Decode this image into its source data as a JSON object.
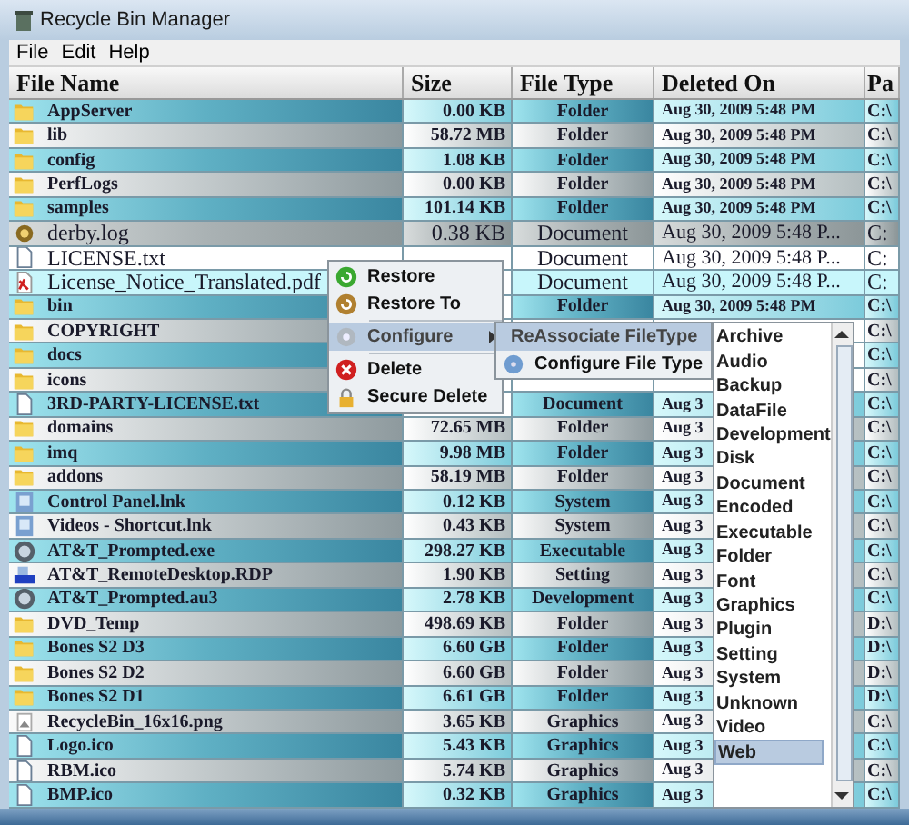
{
  "window": {
    "title": "Recycle Bin Manager"
  },
  "menu_bar": [
    "File",
    "Edit",
    "Help"
  ],
  "table": {
    "columns": [
      "File Name",
      "Size",
      "File Type",
      "Deleted On",
      "Pa"
    ],
    "rows": [
      {
        "name": "AppServer",
        "kind": "folder",
        "size": "0.00 KB",
        "type": "Folder",
        "deleted": "Aug 30, 2009 5:48 PM",
        "path": "C:\\",
        "selected": false
      },
      {
        "name": "lib",
        "kind": "folder",
        "size": "58.72 MB",
        "type": "Folder",
        "deleted": "Aug 30, 2009 5:48 PM",
        "path": "C:\\",
        "selected": false
      },
      {
        "name": "config",
        "kind": "folder",
        "size": "1.08 KB",
        "type": "Folder",
        "deleted": "Aug 30, 2009 5:48 PM",
        "path": "C:\\",
        "selected": false
      },
      {
        "name": "PerfLogs",
        "kind": "folder",
        "size": "0.00 KB",
        "type": "Folder",
        "deleted": "Aug 30, 2009 5:48 PM",
        "path": "C:\\",
        "selected": false
      },
      {
        "name": "samples",
        "kind": "folder",
        "size": "101.14 KB",
        "type": "Folder",
        "deleted": "Aug 30, 2009 5:48 PM",
        "path": "C:\\",
        "selected": false
      },
      {
        "name": "derby.log",
        "kind": "log",
        "size": "0.38 KB",
        "type": "Document",
        "deleted": "Aug 30, 2009 5:48 P...",
        "path": "C:",
        "selected": true
      },
      {
        "name": "LICENSE.txt",
        "kind": "file",
        "type": "Document",
        "deleted": "Aug 30, 2009 5:48 P...",
        "path": "C:",
        "selected": true
      },
      {
        "name": "License_Notice_Translated.pdf",
        "kind": "pdf",
        "type": "Document",
        "deleted": "Aug 30, 2009 5:48 P...",
        "path": "C:",
        "selected": true
      },
      {
        "name": "bin",
        "kind": "folder",
        "type": "Folder",
        "deleted": "Aug 30, 2009 5:48 PM",
        "path": "C:\\",
        "selected": false
      },
      {
        "name": "COPYRIGHT",
        "kind": "folder",
        "path": "C:\\",
        "selected": false
      },
      {
        "name": "docs",
        "kind": "folder",
        "path": "C:\\",
        "selected": false
      },
      {
        "name": "icons",
        "kind": "folder",
        "path": "C:\\",
        "selected": false
      },
      {
        "name": "3RD-PARTY-LICENSE.txt",
        "kind": "file",
        "type": "Document",
        "deleted": "Aug 3",
        "path": "C:\\",
        "selected": false
      },
      {
        "name": "domains",
        "kind": "folder",
        "size": "72.65 MB",
        "type": "Folder",
        "deleted": "Aug 3",
        "path": "C:\\",
        "selected": false
      },
      {
        "name": "imq",
        "kind": "folder",
        "size": "9.98 MB",
        "type": "Folder",
        "deleted": "Aug 3",
        "path": "C:\\",
        "selected": false
      },
      {
        "name": "addons",
        "kind": "folder",
        "size": "58.19 MB",
        "type": "Folder",
        "deleted": "Aug 3",
        "path": "C:\\",
        "selected": false
      },
      {
        "name": "Control Panel.lnk",
        "kind": "shortcut",
        "size": "0.12 KB",
        "type": "System",
        "deleted": "Aug 3",
        "path": "C:\\",
        "selected": false
      },
      {
        "name": "Videos - Shortcut.lnk",
        "kind": "shortcut",
        "size": "0.43 KB",
        "type": "System",
        "deleted": "Aug 3",
        "path": "C:\\",
        "selected": false
      },
      {
        "name": "AT&T_Prompted.exe",
        "kind": "app",
        "size": "298.27 KB",
        "type": "Executable",
        "deleted": "Aug 3",
        "path": "C:\\",
        "selected": false
      },
      {
        "name": "AT&T_RemoteDesktop.RDP",
        "kind": "remote",
        "size": "1.90 KB",
        "type": "Setting",
        "deleted": "Aug 3",
        "path": "C:\\",
        "selected": false
      },
      {
        "name": "AT&T_Prompted.au3",
        "kind": "app",
        "size": "2.78 KB",
        "type": "Development",
        "deleted": "Aug 3",
        "path": "C:\\",
        "selected": false
      },
      {
        "name": "DVD_Temp",
        "kind": "folder",
        "size": "498.69 KB",
        "type": "Folder",
        "deleted": "Aug 3",
        "path": "D:\\",
        "selected": false
      },
      {
        "name": "Bones S2 D3",
        "kind": "folder",
        "size": "6.60 GB",
        "type": "Folder",
        "deleted": "Aug 3",
        "path": "D:\\",
        "selected": false
      },
      {
        "name": "Bones S2 D2",
        "kind": "folder",
        "size": "6.60 GB",
        "type": "Folder",
        "deleted": "Aug 3",
        "path": "D:\\",
        "selected": false
      },
      {
        "name": "Bones S2 D1",
        "kind": "folder",
        "size": "6.61 GB",
        "type": "Folder",
        "deleted": "Aug 3",
        "path": "D:\\",
        "selected": false
      },
      {
        "name": "RecycleBin_16x16.png",
        "kind": "image",
        "size": "3.65 KB",
        "type": "Graphics",
        "deleted": "Aug 3",
        "path": "C:\\",
        "selected": false
      },
      {
        "name": "Logo.ico",
        "kind": "file",
        "size": "5.43 KB",
        "type": "Graphics",
        "deleted": "Aug 3",
        "path": "C:\\",
        "selected": false
      },
      {
        "name": "RBM.ico",
        "kind": "file",
        "size": "5.74 KB",
        "type": "Graphics",
        "deleted": "Aug 3",
        "path": "C:\\",
        "selected": false
      },
      {
        "name": "BMP.ico",
        "kind": "file",
        "size": "0.32 KB",
        "type": "Graphics",
        "deleted": "Aug 3",
        "path": "C:\\",
        "selected": false
      }
    ]
  },
  "context_menu": {
    "items": [
      {
        "kind": "restore",
        "label": "Restore",
        "selected": false
      },
      {
        "kind": "restoreto",
        "label": "Restore To",
        "selected": false
      },
      {
        "kind": "separator"
      },
      {
        "kind": "configure",
        "label": "Configure",
        "selected": true,
        "submenu": true
      },
      {
        "kind": "separator"
      },
      {
        "kind": "delete",
        "label": "Delete",
        "selected": false
      },
      {
        "kind": "lock",
        "label": "Secure Delete",
        "selected": false
      }
    ]
  },
  "submenu": {
    "items": [
      {
        "kind": "gear",
        "label": "ReAssociate FileType",
        "selected": true,
        "submenu": true
      },
      {
        "kind": "disc",
        "label": "Configure File Type",
        "selected": false,
        "submenu": false
      }
    ]
  },
  "file_type_list": {
    "items": [
      {
        "label": "Archive",
        "selected": false
      },
      {
        "label": "Audio",
        "selected": false
      },
      {
        "label": "Backup",
        "selected": false
      },
      {
        "label": "DataFile",
        "selected": false
      },
      {
        "label": "Development",
        "selected": false
      },
      {
        "label": "Disk",
        "selected": false
      },
      {
        "label": "Document",
        "selected": false
      },
      {
        "label": "Encoded",
        "selected": false
      },
      {
        "label": "Executable",
        "selected": false
      },
      {
        "label": "Folder",
        "selected": false
      },
      {
        "label": "Font",
        "selected": false
      },
      {
        "label": "Graphics",
        "selected": false
      },
      {
        "label": "Plugin",
        "selected": false
      },
      {
        "label": "Setting",
        "selected": false
      },
      {
        "label": "System",
        "selected": false
      },
      {
        "label": "Unknown",
        "selected": false
      },
      {
        "label": "Video",
        "selected": false
      },
      {
        "label": "Web",
        "selected": true
      }
    ]
  }
}
